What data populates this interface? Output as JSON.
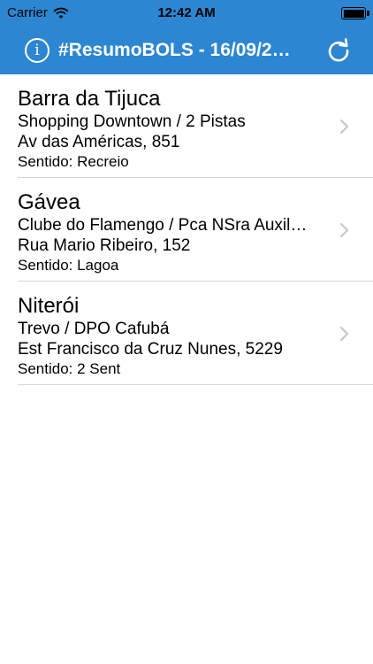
{
  "status_bar": {
    "carrier": "Carrier",
    "time": "12:42 AM"
  },
  "nav": {
    "info_glyph": "i",
    "title": "#ResumoBOLS - 16/09/2…",
    "info_icon": "info-circle-icon",
    "refresh_icon": "refresh-icon"
  },
  "colors": {
    "nav_background": "#2c86d2",
    "nav_text": "#ffffff",
    "separator": "#d6d6da",
    "chevron": "#c7c7cc"
  },
  "list": {
    "items": [
      {
        "title": "Barra da Tijuca",
        "location": "Shopping Downtown / 2 Pistas",
        "address": "Av das Américas, 851",
        "direction": "Sentido: Recreio"
      },
      {
        "title": "Gávea",
        "location": "Clube do Flamengo / Pca NSra Auxil…",
        "address": "Rua Mario Ribeiro, 152",
        "direction": "Sentido: Lagoa"
      },
      {
        "title": "Niterói",
        "location": "Trevo / DPO Cafubá",
        "address": "Est Francisco da Cruz Nunes, 5229",
        "direction": "Sentido: 2 Sent"
      }
    ]
  }
}
